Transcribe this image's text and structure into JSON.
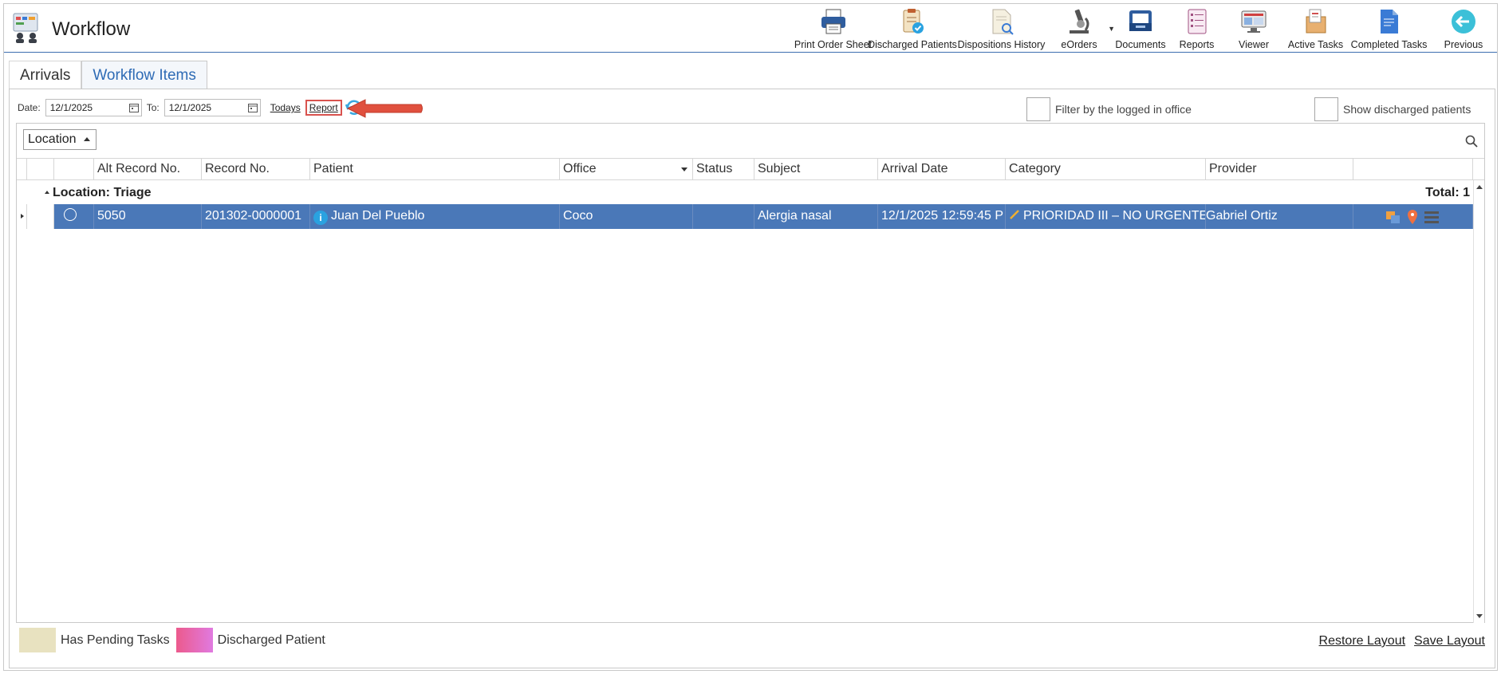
{
  "app": {
    "title": "Workflow"
  },
  "toolbar": [
    {
      "label": "Print Order Sheet",
      "icon": "printer-icon",
      "name": "print-order-sheet-button"
    },
    {
      "label": "Discharged Patients",
      "icon": "clipboard-check-icon",
      "name": "discharged-patients-button"
    },
    {
      "label": "Dispositions History",
      "icon": "document-search-icon",
      "name": "dispositions-history-button"
    },
    {
      "label": "eOrders",
      "icon": "microscope-icon",
      "name": "eorders-button"
    },
    {
      "label": "Documents",
      "icon": "inbox-tray-icon",
      "name": "documents-button"
    },
    {
      "label": "Reports",
      "icon": "report-list-icon",
      "name": "reports-button"
    },
    {
      "label": "Viewer",
      "icon": "monitor-icon",
      "name": "viewer-button"
    },
    {
      "label": "Active Tasks",
      "icon": "task-box-icon",
      "name": "active-tasks-button"
    },
    {
      "label": "Completed Tasks",
      "icon": "completed-doc-icon",
      "name": "completed-tasks-button"
    },
    {
      "label": "Previous",
      "icon": "back-arrow-icon",
      "name": "previous-button"
    }
  ],
  "tabs": {
    "arrivals": "Arrivals",
    "workflow_items": "Workflow Items"
  },
  "filters": {
    "date_label": "Date:",
    "date_from": "12/1/2025",
    "to_label": "To:",
    "date_to": "12/1/2025",
    "todays": "Todays",
    "report": "Report",
    "filter_office": "Filter by the logged in office",
    "show_discharged": "Show discharged patients"
  },
  "grid": {
    "group_by": "Location",
    "columns": [
      "Alt Record No.",
      "Record No.",
      "Patient",
      "Office",
      "Status",
      "Subject",
      "Arrival Date",
      "Category",
      "Provider"
    ],
    "group": {
      "label": "Location: Triage",
      "total": "Total: 1"
    },
    "rows": [
      {
        "alt_record": "5050",
        "record": "201302-0000001",
        "patient": "Juan Del Pueblo",
        "office": "Coco",
        "status": "",
        "subject": "Alergia nasal",
        "arrival": "12/1/2025 12:59:45 P",
        "category": "PRIORIDAD III – NO URGENTE",
        "provider": "Gabriel Ortiz"
      }
    ]
  },
  "legend": {
    "pending": {
      "label": "Has Pending Tasks",
      "color": "#e8e2c0"
    },
    "discharged": {
      "label": "Discharged Patient",
      "color": "#e85c9a"
    }
  },
  "layout": {
    "restore": "Restore Layout",
    "save": "Save Layout"
  },
  "colors": {
    "selected_row": "#4a78b8",
    "tab_link": "#2e6bb5",
    "highlight": "#d9534f"
  }
}
